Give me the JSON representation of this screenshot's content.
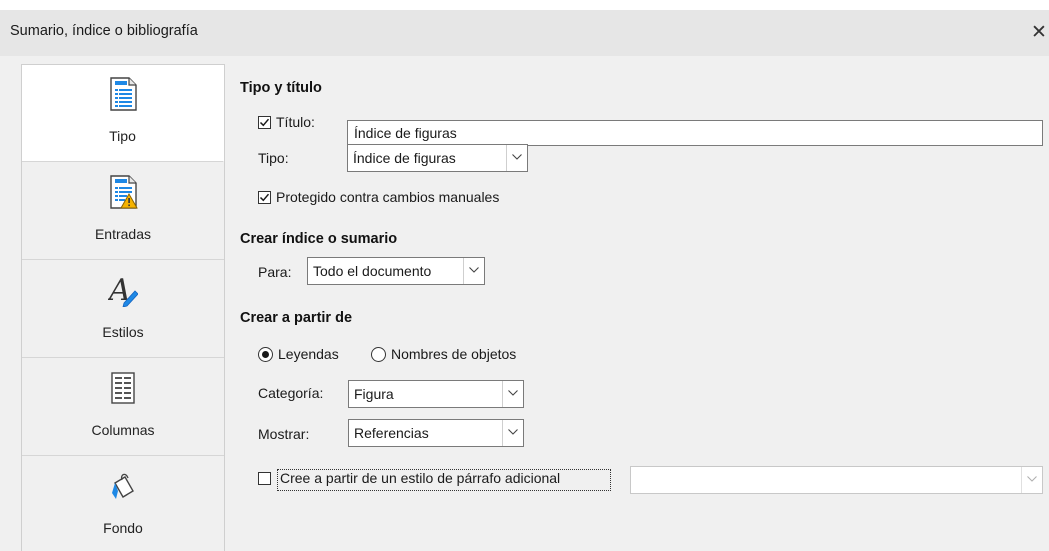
{
  "window": {
    "title": "Sumario, índice o bibliografía",
    "close_glyph": "✕"
  },
  "nav": {
    "items": [
      {
        "label": "Tipo",
        "icon": "document-list-icon",
        "active": true
      },
      {
        "label": "Entradas",
        "icon": "document-warning-icon",
        "active": false
      },
      {
        "label": "Estilos",
        "icon": "style-pen-icon",
        "active": false
      },
      {
        "label": "Columnas",
        "icon": "columns-icon",
        "active": false
      },
      {
        "label": "Fondo",
        "icon": "paint-bucket-icon",
        "active": false
      }
    ]
  },
  "type_title": {
    "heading": "Tipo y título",
    "title_checkbox_label": "Título:",
    "title_checked": true,
    "title_value": "Índice de figuras",
    "type_label": "Tipo:",
    "type_value": "Índice de figuras",
    "protected_label": "Protegido contra cambios manuales",
    "protected_checked": true
  },
  "create_index": {
    "heading": "Crear índice o sumario",
    "for_label": "Para:",
    "for_value": "Todo el documento"
  },
  "create_from": {
    "heading": "Crear a partir de",
    "radio_captions": "Leyendas",
    "radio_object_names": "Nombres de objetos",
    "selected": "Leyendas",
    "category_label": "Categoría:",
    "category_value": "Figura",
    "display_label": "Mostrar:",
    "display_value": "Referencias",
    "additional_style_label": "Cree a partir de un estilo de párrafo adicional",
    "additional_style_checked": false,
    "additional_style_value": ""
  }
}
